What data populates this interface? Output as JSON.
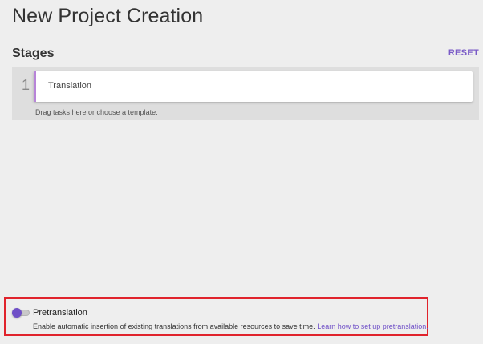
{
  "page": {
    "title": "New Project Creation"
  },
  "stages": {
    "title": "Stages",
    "reset_label": "RESET",
    "items": [
      {
        "number": "1",
        "label": "Translation"
      }
    ],
    "hint": "Drag tasks here or choose a template."
  },
  "pretranslation": {
    "label": "Pretranslation",
    "description": "Enable automatic insertion of existing translations from available resources to save time.",
    "link_text": "Learn how to set up pretranslation.",
    "enabled": false
  },
  "colors": {
    "accent": "#6f4fc7",
    "stage_border": "#b784d8",
    "highlight_box": "#e0232c",
    "background": "#eeeeee"
  }
}
